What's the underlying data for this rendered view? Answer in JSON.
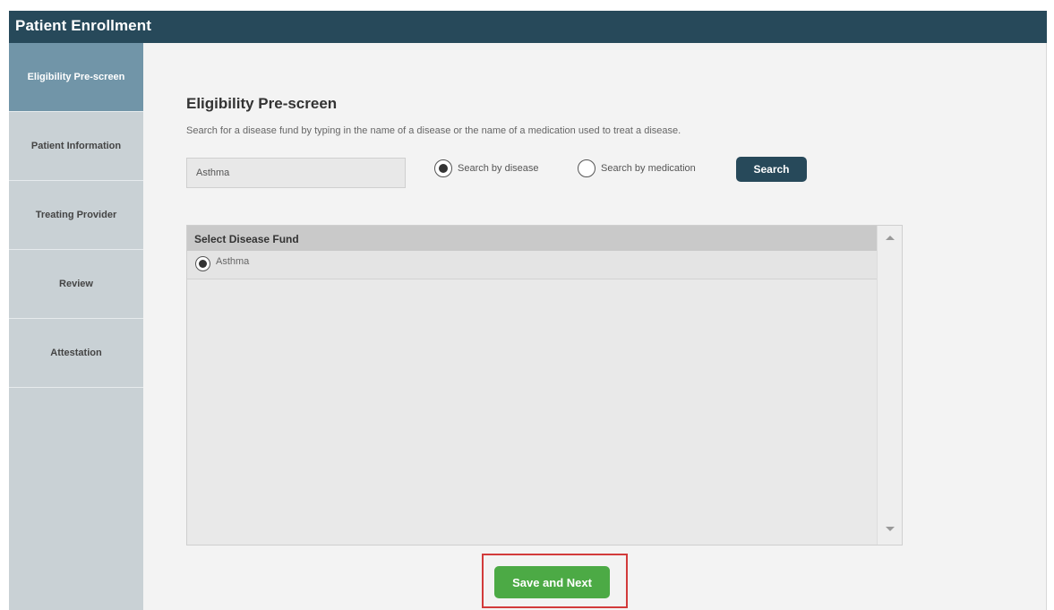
{
  "header": {
    "title": "Patient Enrollment"
  },
  "sidebar": {
    "items": [
      {
        "label": "Eligibility Pre-screen",
        "active": true
      },
      {
        "label": "Patient Information",
        "active": false
      },
      {
        "label": "Treating Provider",
        "active": false
      },
      {
        "label": "Review",
        "active": false
      },
      {
        "label": "Attestation",
        "active": false
      }
    ]
  },
  "main": {
    "title": "Eligibility Pre-screen",
    "description": "Search for a disease fund by typing in the name of a disease or the name of a medication used to treat a disease.",
    "search": {
      "value": "Asthma",
      "placeholder": ""
    },
    "radios": {
      "by_disease": {
        "label": "Search by disease",
        "checked": true
      },
      "by_medication": {
        "label": "Search by medication",
        "checked": false
      }
    },
    "search_button": "Search",
    "grid": {
      "header": "Select Disease Fund",
      "rows": [
        {
          "label": "Asthma",
          "selected": true
        }
      ]
    },
    "save_button": "Save and Next"
  },
  "colors": {
    "header_bg": "#27495a",
    "sidebar_active": "#7195a8",
    "sidebar_bg": "#c9d1d5",
    "primary_button": "#27495a",
    "save_button": "#4caa45",
    "highlight": "#d23b3b"
  }
}
